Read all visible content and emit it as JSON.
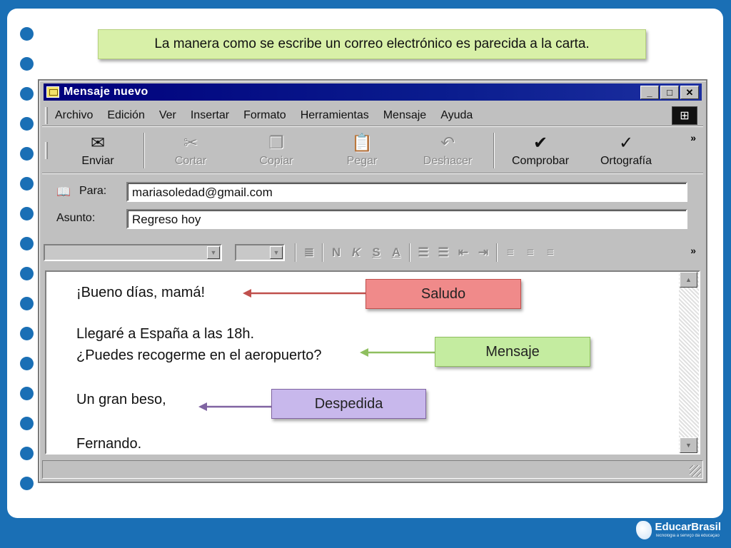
{
  "slide": {
    "title": "La manera como se escribe un correo electrónico es parecida a la carta.",
    "logo": {
      "name": "EducarBrasil",
      "tagline": "Tecnologia a serviço da educação"
    }
  },
  "window": {
    "title": "Mensaje nuevo",
    "controls": {
      "minimize": "_",
      "maximize": "□",
      "close": "✕"
    }
  },
  "menu": [
    "Archivo",
    "Edición",
    "Ver",
    "Insertar",
    "Formato",
    "Herramientas",
    "Mensaje",
    "Ayuda"
  ],
  "toolbar": [
    {
      "label": "Enviar",
      "icon": "send-icon",
      "glyph": "✉",
      "enabled": true
    },
    {
      "label": "Cortar",
      "icon": "scissors-icon",
      "glyph": "✂",
      "enabled": false
    },
    {
      "label": "Copiar",
      "icon": "copy-icon",
      "glyph": "❐",
      "enabled": false
    },
    {
      "label": "Pegar",
      "icon": "paste-icon",
      "glyph": "📋",
      "enabled": false
    },
    {
      "label": "Deshacer",
      "icon": "undo-icon",
      "glyph": "↶",
      "enabled": false
    },
    {
      "label": "Comprobar",
      "icon": "check-names-icon",
      "glyph": "✔",
      "enabled": true
    },
    {
      "label": "Ortografía",
      "icon": "spellcheck-icon",
      "glyph": "✓",
      "enabled": true
    }
  ],
  "header": {
    "to_label": "Para:",
    "to_value": "mariasoledad@gmail.com",
    "subject_label": "Asunto:",
    "subject_value": "Regreso hoy"
  },
  "body": {
    "greeting": "¡Bueno días, mamá!",
    "line1": "Llegaré a España a las 18h.",
    "line2": "¿Puedes recogerme en el aeropuerto?",
    "closing": "Un gran beso,",
    "signature": "Fernando."
  },
  "annotations": {
    "greeting": {
      "label": "Saludo",
      "color": "#f08a8a",
      "arrow_color": "#c0504d"
    },
    "message": {
      "label": "Mensaje",
      "color": "#c4eca0",
      "arrow_color": "#8fbf5f"
    },
    "closing": {
      "label": "Despedida",
      "color": "#c8b8ec",
      "arrow_color": "#8064a2"
    }
  },
  "colors": {
    "background": "#1a6fb5",
    "title_bg": "#d8f0a8",
    "titlebar": "#00007c"
  }
}
